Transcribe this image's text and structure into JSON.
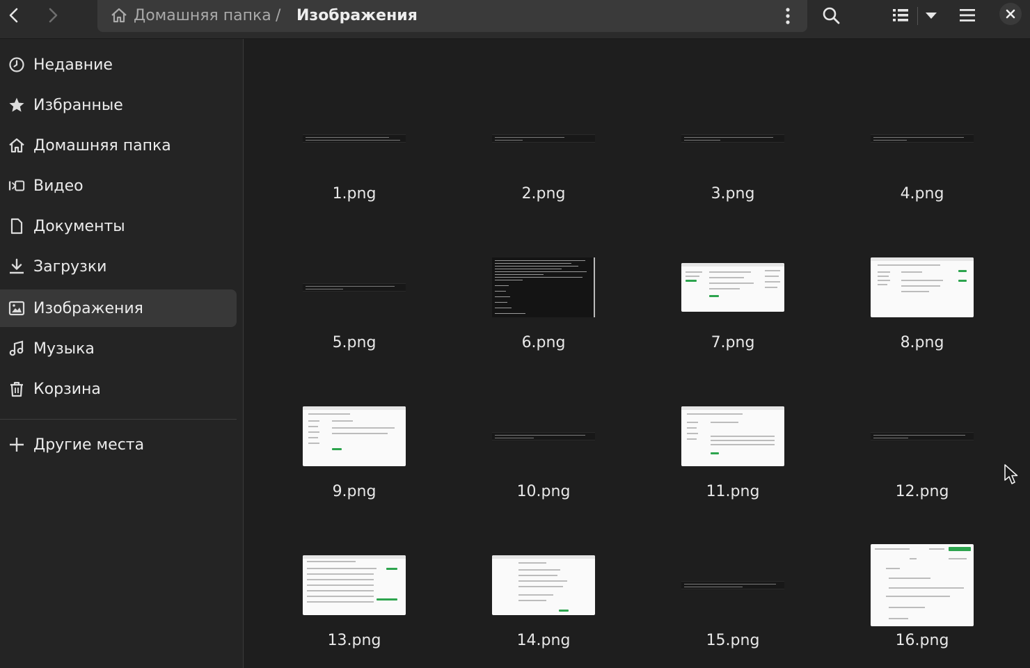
{
  "header": {
    "back_icon": "go-back-icon",
    "forward_icon": "go-forward-icon",
    "breadcrumb": {
      "home_label": "Домашняя папка",
      "separator": "/",
      "current_label": "Изображения"
    },
    "icons": [
      "search-icon",
      "list-view-icon",
      "view-options-dropdown-icon",
      "main-menu-icon",
      "close-icon"
    ]
  },
  "sidebar": {
    "items": [
      {
        "label": "Недавние",
        "icon": "clock-icon"
      },
      {
        "label": "Избранные",
        "icon": "star-icon"
      },
      {
        "label": "Домашняя папка",
        "icon": "home-icon"
      },
      {
        "label": "Видео",
        "icon": "video-icon"
      },
      {
        "label": "Документы",
        "icon": "document-icon"
      },
      {
        "label": "Загрузки",
        "icon": "download-icon"
      },
      {
        "label": "Изображения",
        "icon": "image-icon",
        "active": true
      },
      {
        "label": "Музыка",
        "icon": "music-icon"
      },
      {
        "label": "Корзина",
        "icon": "trash-icon"
      }
    ],
    "other_places": {
      "label": "Другие места",
      "icon": "plus-icon"
    }
  },
  "files": [
    {
      "name": "1.png",
      "thumb": "terminal"
    },
    {
      "name": "2.png",
      "thumb": "terminal"
    },
    {
      "name": "3.png",
      "thumb": "terminal"
    },
    {
      "name": "4.png",
      "thumb": "terminal"
    },
    {
      "name": "5.png",
      "thumb": "terminal"
    },
    {
      "name": "6.png",
      "thumb": "terminal-large"
    },
    {
      "name": "7.png",
      "thumb": "webpage"
    },
    {
      "name": "8.png",
      "thumb": "webpage"
    },
    {
      "name": "9.png",
      "thumb": "webpage"
    },
    {
      "name": "10.png",
      "thumb": "terminal"
    },
    {
      "name": "11.png",
      "thumb": "webpage"
    },
    {
      "name": "12.png",
      "thumb": "terminal"
    },
    {
      "name": "13.png",
      "thumb": "webpage"
    },
    {
      "name": "14.png",
      "thumb": "webpage"
    },
    {
      "name": "15.png",
      "thumb": "terminal"
    },
    {
      "name": "16.png",
      "thumb": "webpage"
    }
  ],
  "colors": {
    "window_bg": "#1e1e1e",
    "sidebar_bg": "#242424",
    "header_bg": "#2b2b2b",
    "active_item_bg": "#383838",
    "accent_green": "#2da44e"
  }
}
